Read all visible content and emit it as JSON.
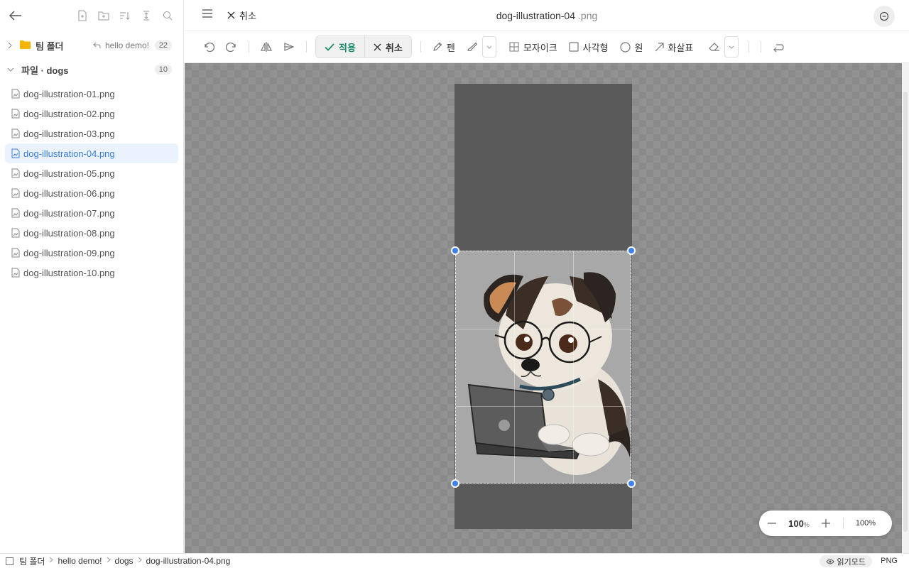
{
  "sidebar": {
    "team_folder": {
      "label": "팀 폴더",
      "recent": "hello demo!",
      "count": "22"
    },
    "files_section": {
      "label": "파일 · dogs",
      "count": "10"
    },
    "files": [
      "dog-illustration-01.png",
      "dog-illustration-02.png",
      "dog-illustration-03.png",
      "dog-illustration-04.png",
      "dog-illustration-05.png",
      "dog-illustration-06.png",
      "dog-illustration-07.png",
      "dog-illustration-08.png",
      "dog-illustration-09.png",
      "dog-illustration-10.png"
    ],
    "active_index": 3
  },
  "header": {
    "cancel_label": "취소",
    "title": "dog-illustration-04",
    "ext": ".png"
  },
  "toolbar": {
    "apply": "적용",
    "cancel": "취소",
    "pen": "펜",
    "mosaic": "모자이크",
    "rect": "사각형",
    "circle": "원",
    "arrow": "화살표"
  },
  "zoom": {
    "value": "100",
    "unit": "%",
    "fit": "100%"
  },
  "statusbar": {
    "crumbs": [
      "팀 폴더",
      "hello demo!",
      "dogs",
      "dog-illustration-04.png"
    ],
    "read_mode": "읽기모드",
    "format": "PNG"
  },
  "colors": {
    "accent": "#3a82f0",
    "apply": "#1a8a6a",
    "active_bg": "#eaf2fe"
  }
}
